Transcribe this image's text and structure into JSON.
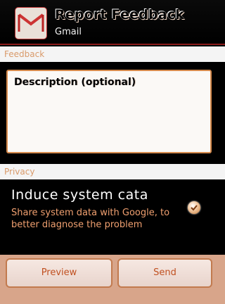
{
  "header": {
    "title": "Report Feedback",
    "subtitle": "Gmail",
    "icon": "gmail-envelope-icon"
  },
  "feedback_section": {
    "header": "Feedback",
    "description_placeholder": "Description (optional)"
  },
  "privacy_section": {
    "header": "Privacy",
    "option_title": "Induce system cata",
    "option_description": "Share system data with Google, to better diagnose the problem",
    "checked": true
  },
  "buttons": {
    "preview_label": "Preview",
    "send_label": "Send"
  },
  "colors": {
    "accent": "#d68a4c",
    "bottom_bar": "#d8a58a",
    "description_text": "#f0a070"
  }
}
